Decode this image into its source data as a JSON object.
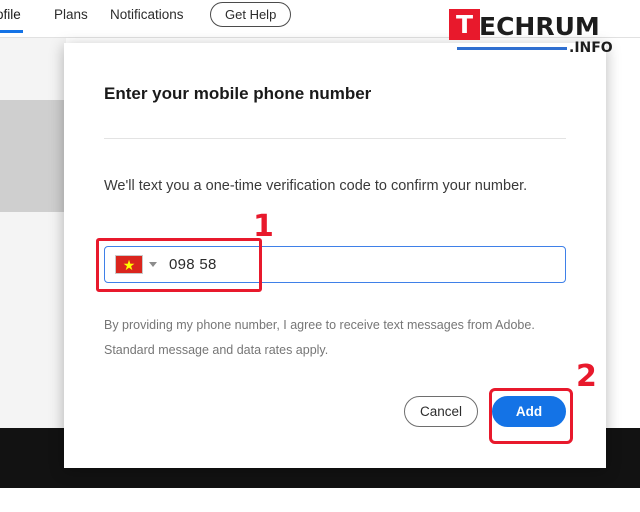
{
  "page": {
    "nav": {
      "profile_label": "ofile",
      "plans_label": "Plans",
      "notifications_label": "Notifications",
      "get_help_label": "Get Help"
    },
    "watermark": {
      "letter": "T",
      "rest": "ECHRUM",
      "suffix": ".INFO",
      "accent_color": "#e8192c",
      "bar_color": "#2f6fd0"
    }
  },
  "modal": {
    "title": "Enter your mobile phone number",
    "description": "We'll text you a one-time verification code to confirm your number.",
    "phone_field": {
      "country_flag": "vietnam-flag",
      "value": "098 58",
      "placeholder": ""
    },
    "legal_text": "By providing my phone number, I agree to receive text messages from Adobe. Standard message and data rates apply.",
    "cancel_label": "Cancel",
    "add_label": "Add",
    "accent_color": "#1473e6"
  },
  "annotations": {
    "step_1": "1",
    "step_2": "2",
    "color": "#e8192c"
  }
}
